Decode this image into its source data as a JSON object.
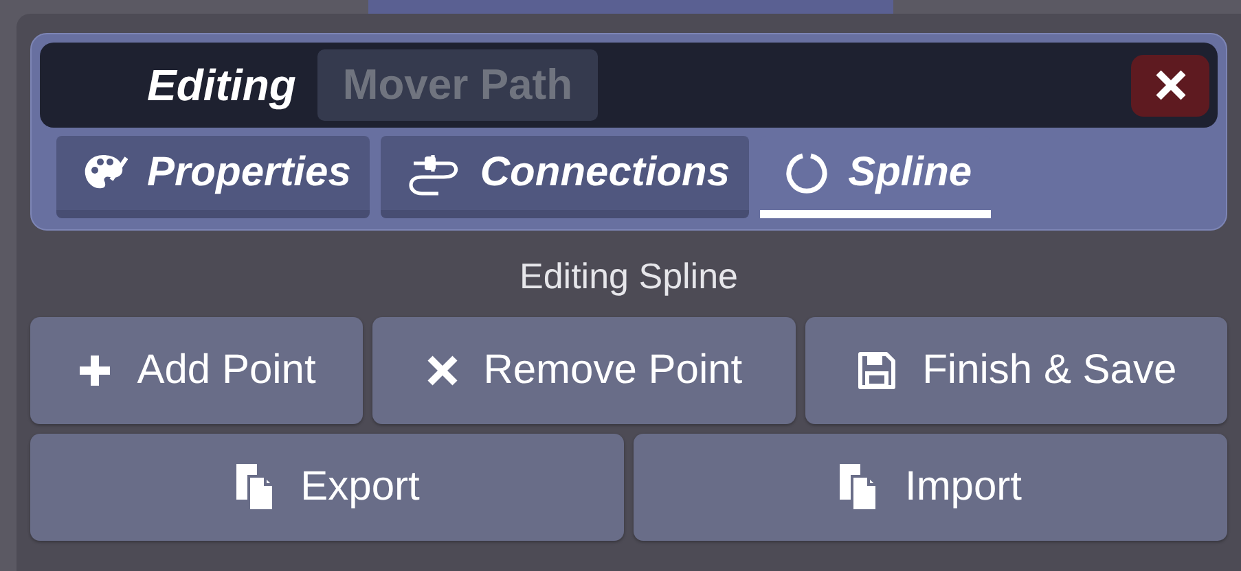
{
  "header": {
    "mode": "Editing",
    "object_name": "Mover Path"
  },
  "tabs": [
    {
      "label": "Properties",
      "selected": false
    },
    {
      "label": "Connections",
      "selected": false
    },
    {
      "label": "Spline",
      "selected": true
    }
  ],
  "section_title": "Editing Spline",
  "actions": [
    {
      "label": "Add Point"
    },
    {
      "label": "Remove Point"
    },
    {
      "label": "Finish & Save"
    }
  ],
  "transfer": [
    {
      "label": "Export"
    },
    {
      "label": "Import"
    }
  ]
}
